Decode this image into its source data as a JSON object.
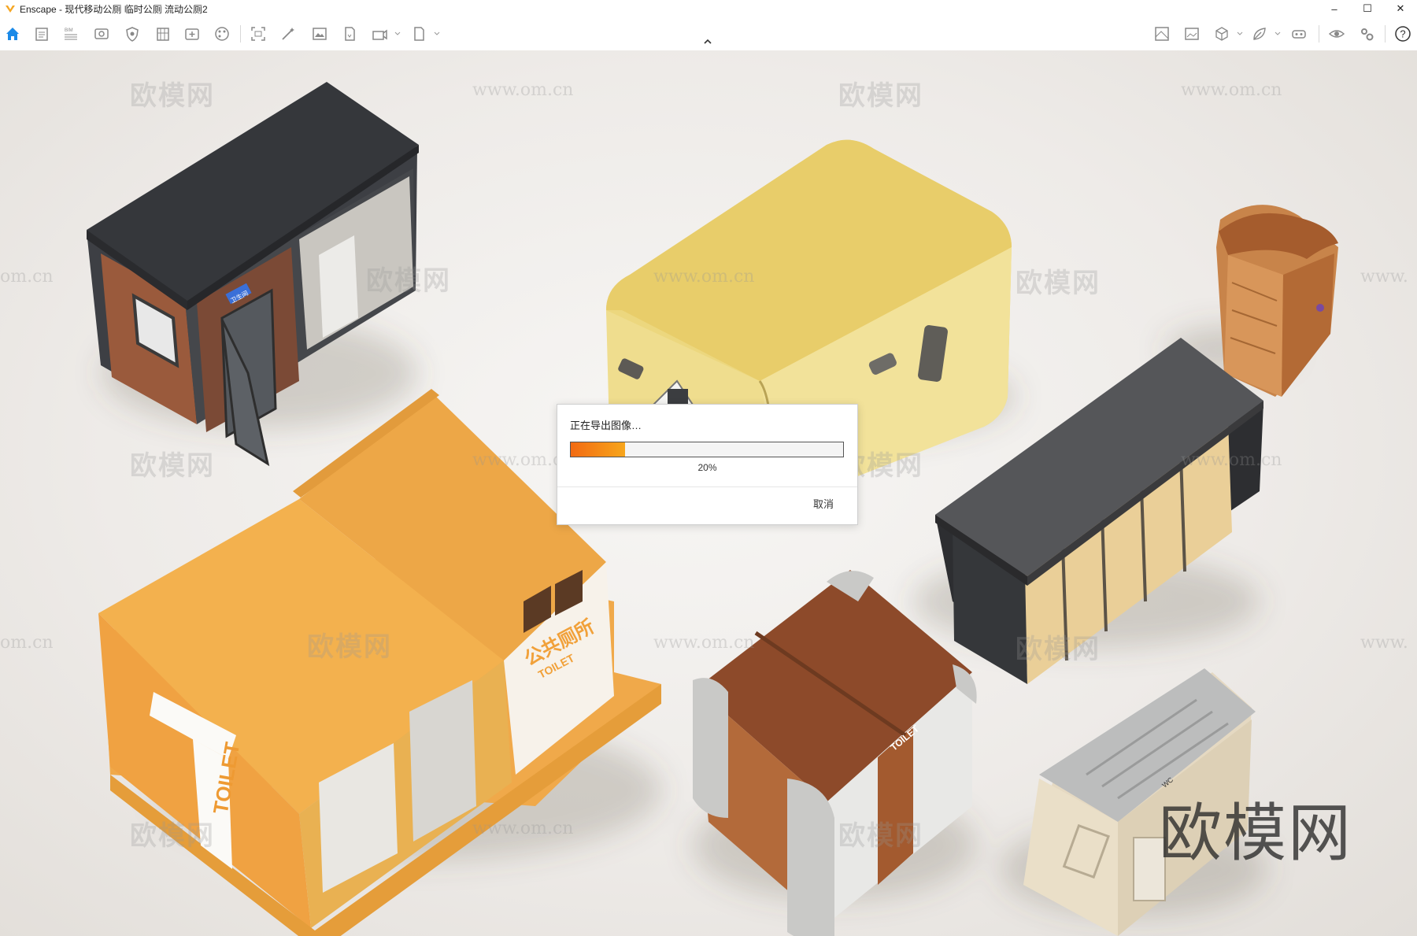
{
  "window": {
    "title": "Enscape - 现代移动公厕 临时公厕 流动公厕2",
    "minimize": "–",
    "maximize": "☐",
    "close": "✕"
  },
  "toolbar": {
    "left_icons": [
      "home-icon",
      "project-icon",
      "bim-icon",
      "visual-settings-icon",
      "shield-icon",
      "building-icon",
      "add-view-icon",
      "materials-icon",
      "capture-icon",
      "magic-icon",
      "image-icon",
      "export-icon",
      "render-icon",
      "file-icon"
    ],
    "bim_label": "BIM",
    "right_icons": [
      "map-icon",
      "gallery-icon",
      "cube-icon",
      "leaf-icon",
      "vr-icon",
      "eye-icon",
      "settings-icon",
      "help-icon"
    ],
    "help_label": "?"
  },
  "watermarks": {
    "logo_text": "欧模网",
    "url_text": "www.om.cn",
    "partial_left": "om.cn",
    "partial_right": "www."
  },
  "scene": {
    "sign_public": "公共厕所",
    "sign_toilet": "TOILET",
    "sign_vertical": "TOILET",
    "sign_cabin": "卫生间",
    "sign_brown": "TOILET",
    "sign_wc": "WC"
  },
  "dialog": {
    "title": "正在导出图像…",
    "progress": 0.2,
    "progress_label": "20%",
    "cancel_label": "取消"
  },
  "colors": {
    "accent_blue": "#1b8ae8",
    "progress_start": "#f26a12",
    "progress_end": "#f7a61c"
  }
}
